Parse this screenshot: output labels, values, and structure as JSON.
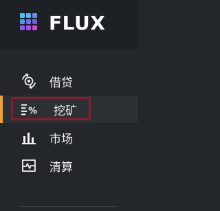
{
  "brand": {
    "name": "FLUX",
    "logo_icon": "flux-logo-icon",
    "logo_gradient": [
      "#3ec8f0",
      "#6a5cf0",
      "#d04ae0"
    ]
  },
  "colors": {
    "sidebar_bg": "#23272b",
    "header_bg": "#1d2125",
    "active_accent": "#f0a032",
    "highlight_border": "#8c1a2e",
    "text": "#f2f2f2"
  },
  "nav": {
    "items": [
      {
        "label": "借贷",
        "icon": "lending-icon",
        "active": false
      },
      {
        "label": "挖矿",
        "icon": "mining-icon",
        "active": true
      },
      {
        "label": "市场",
        "icon": "market-chart-icon",
        "active": false
      },
      {
        "label": "清算",
        "icon": "liquidation-icon",
        "active": false
      }
    ]
  }
}
